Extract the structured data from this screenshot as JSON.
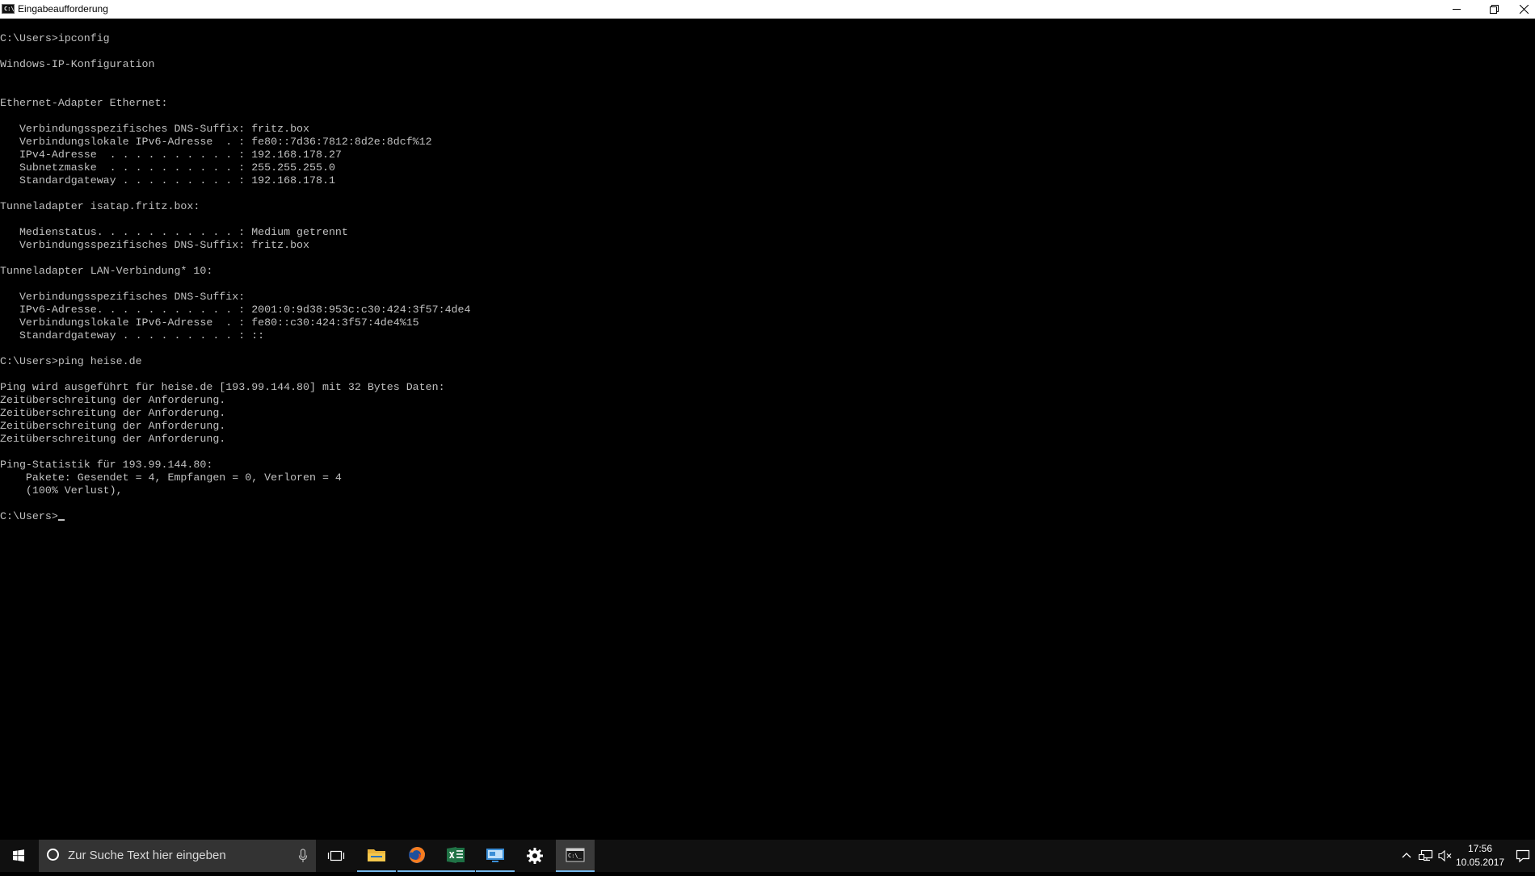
{
  "window": {
    "title": "Eingabeaufforderung",
    "icon_label": "C:\\"
  },
  "console": {
    "lines": [
      "C:\\Users>ipconfig",
      "",
      "Windows-IP-Konfiguration",
      "",
      "",
      "Ethernet-Adapter Ethernet:",
      "",
      "   Verbindungsspezifisches DNS-Suffix: fritz.box",
      "   Verbindungslokale IPv6-Adresse  . : fe80::7d36:7812:8d2e:8dcf%12",
      "   IPv4-Adresse  . . . . . . . . . . : 192.168.178.27",
      "   Subnetzmaske  . . . . . . . . . . : 255.255.255.0",
      "   Standardgateway . . . . . . . . . : 192.168.178.1",
      "",
      "Tunneladapter isatap.fritz.box:",
      "",
      "   Medienstatus. . . . . . . . . . . : Medium getrennt",
      "   Verbindungsspezifisches DNS-Suffix: fritz.box",
      "",
      "Tunneladapter LAN-Verbindung* 10:",
      "",
      "   Verbindungsspezifisches DNS-Suffix:",
      "   IPv6-Adresse. . . . . . . . . . . : 2001:0:9d38:953c:c30:424:3f57:4de4",
      "   Verbindungslokale IPv6-Adresse  . : fe80::c30:424:3f57:4de4%15",
      "   Standardgateway . . . . . . . . . : ::",
      "",
      "C:\\Users>ping heise.de",
      "",
      "Ping wird ausgeführt für heise.de [193.99.144.80] mit 32 Bytes Daten:",
      "Zeitüberschreitung der Anforderung.",
      "Zeitüberschreitung der Anforderung.",
      "Zeitüberschreitung der Anforderung.",
      "Zeitüberschreitung der Anforderung.",
      "",
      "Ping-Statistik für 193.99.144.80:",
      "    Pakete: Gesendet = 4, Empfangen = 0, Verloren = 4",
      "    (100% Verlust),",
      ""
    ],
    "prompt": "C:\\Users>"
  },
  "taskbar": {
    "search_placeholder": "Zur Suche Text hier eingeben",
    "apps": [
      {
        "name": "task-view",
        "icon": "task-view-icon"
      },
      {
        "name": "file-explorer",
        "icon": "folder-icon"
      },
      {
        "name": "firefox",
        "icon": "firefox-icon"
      },
      {
        "name": "excel",
        "icon": "excel-icon"
      },
      {
        "name": "remote-desktop",
        "icon": "remote-desktop-icon"
      },
      {
        "name": "settings",
        "icon": "gear-icon"
      },
      {
        "name": "command-prompt",
        "icon": "cmd-icon"
      }
    ],
    "clock_time": "17:56",
    "clock_date": "10.05.2017"
  },
  "colors": {
    "console_bg": "#000000",
    "console_text": "#c0c0c0",
    "taskbar_bg": "#101010",
    "accent": "#76b9ed"
  }
}
